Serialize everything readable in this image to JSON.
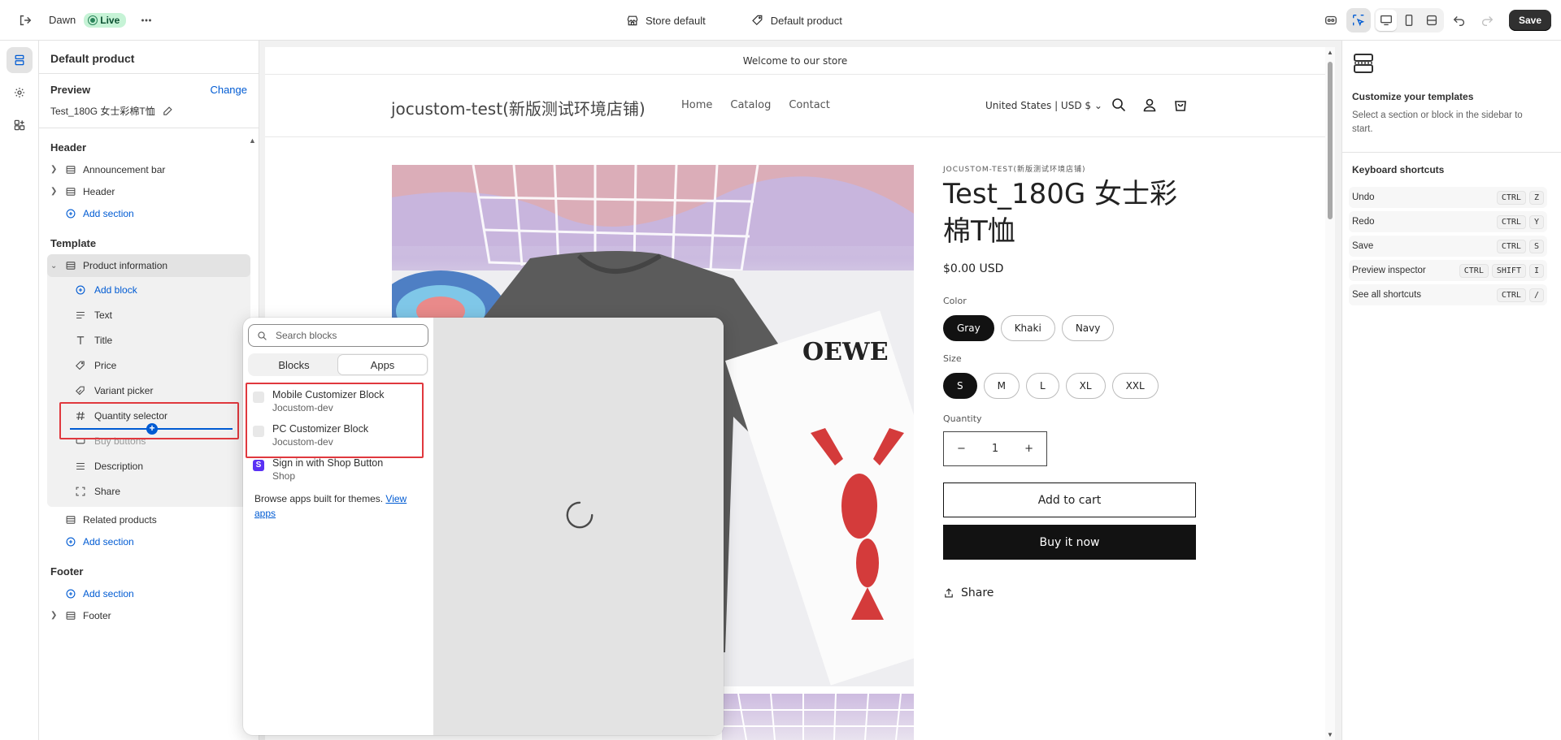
{
  "topbar": {
    "theme_name": "Dawn",
    "live_label": "Live",
    "store_label": "Store default",
    "template_label": "Default product",
    "save_label": "Save"
  },
  "sidebar": {
    "title": "Default product",
    "preview_label": "Preview",
    "change_label": "Change",
    "preview_product": "Test_180G 女士彩棉T恤",
    "header_section": "Header",
    "header_items": [
      "Announcement bar",
      "Header"
    ],
    "add_section": "Add section",
    "template_section": "Template",
    "product_info": "Product information",
    "add_block": "Add block",
    "blocks": [
      "Text",
      "Title",
      "Price",
      "Variant picker",
      "Quantity selector",
      "Buy buttons",
      "Description",
      "Share"
    ],
    "related_products": "Related products",
    "footer_section": "Footer",
    "footer_item": "Footer"
  },
  "popover": {
    "search_placeholder": "Search blocks",
    "tabs": [
      "Blocks",
      "Apps"
    ],
    "apps": [
      {
        "name": "Mobile Customizer Block",
        "vendor": "Jocustom-dev"
      },
      {
        "name": "PC Customizer Block",
        "vendor": "Jocustom-dev"
      },
      {
        "name": "Sign in with Shop Button",
        "vendor": "Shop"
      }
    ],
    "browse_text": "Browse apps built for themes.",
    "view_apps": "View apps"
  },
  "store": {
    "announcement": "Welcome to our store",
    "logo": "jocustom-test(新版测试环境店铺)",
    "nav": [
      "Home",
      "Catalog",
      "Contact"
    ],
    "locale": "United States | USD $",
    "vendor": "JOCUSTOM-TEST(新版测试环境店铺)",
    "title": "Test_180G 女士彩棉T恤",
    "price": "$0.00 USD",
    "color_label": "Color",
    "colors": [
      "Gray",
      "Khaki",
      "Navy"
    ],
    "size_label": "Size",
    "sizes": [
      "S",
      "M",
      "L",
      "XL",
      "XXL"
    ],
    "quantity_label": "Quantity",
    "quantity": "1",
    "add_to_cart": "Add to cart",
    "buy_now": "Buy it now",
    "share": "Share",
    "image_text": "OEWE"
  },
  "right_panel": {
    "title": "Customize your templates",
    "desc": "Select a section or block in the sidebar to start.",
    "kb_title": "Keyboard shortcuts",
    "shortcuts": [
      {
        "label": "Undo",
        "keys": [
          "CTRL",
          "Z"
        ]
      },
      {
        "label": "Redo",
        "keys": [
          "CTRL",
          "Y"
        ]
      },
      {
        "label": "Save",
        "keys": [
          "CTRL",
          "S"
        ]
      },
      {
        "label": "Preview inspector",
        "keys": [
          "CTRL",
          "SHIFT",
          "I"
        ]
      },
      {
        "label": "See all shortcuts",
        "keys": [
          "CTRL",
          "/"
        ]
      }
    ]
  },
  "colors": {
    "accent": "#005bd3",
    "highlight_box": "#e0383e",
    "live": "#29845a"
  }
}
